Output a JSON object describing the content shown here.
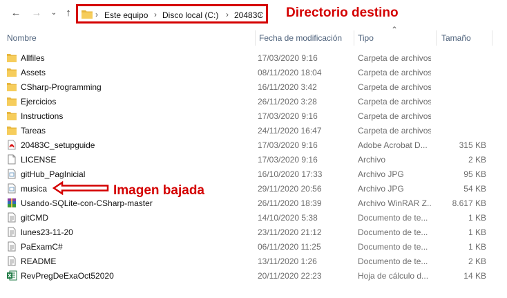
{
  "breadcrumb": [
    "Este equipo",
    "Disco local (C:)",
    "20483C"
  ],
  "annotations": {
    "directory": "Directorio destino",
    "image": "Imagen bajada"
  },
  "columns": {
    "name": "Nombre",
    "date": "Fecha de modificación",
    "type": "Tipo",
    "size": "Tamaño"
  },
  "files": [
    {
      "name": "Allfiles",
      "date": "17/03/2020 9:16",
      "type": "Carpeta de archivos",
      "size": "",
      "icon": "folder-icon"
    },
    {
      "name": "Assets",
      "date": "08/11/2020 18:04",
      "type": "Carpeta de archivos",
      "size": "",
      "icon": "folder-icon"
    },
    {
      "name": "CSharp-Programming",
      "date": "16/11/2020 3:42",
      "type": "Carpeta de archivos",
      "size": "",
      "icon": "folder-icon"
    },
    {
      "name": "Ejercicios",
      "date": "26/11/2020 3:28",
      "type": "Carpeta de archivos",
      "size": "",
      "icon": "folder-icon"
    },
    {
      "name": "Instructions",
      "date": "17/03/2020 9:16",
      "type": "Carpeta de archivos",
      "size": "",
      "icon": "folder-icon"
    },
    {
      "name": "Tareas",
      "date": "24/11/2020 16:47",
      "type": "Carpeta de archivos",
      "size": "",
      "icon": "folder-icon"
    },
    {
      "name": "20483C_setupguide",
      "date": "17/03/2020 9:16",
      "type": "Adobe Acrobat D...",
      "size": "315 KB",
      "icon": "pdf-icon"
    },
    {
      "name": "LICENSE",
      "date": "17/03/2020 9:16",
      "type": "Archivo",
      "size": "2 KB",
      "icon": "file-icon"
    },
    {
      "name": "gitHub_PagInicial",
      "date": "16/10/2020 17:33",
      "type": "Archivo JPG",
      "size": "95 KB",
      "icon": "image-file-icon"
    },
    {
      "name": "musica",
      "date": "29/11/2020 20:56",
      "type": "Archivo JPG",
      "size": "54 KB",
      "icon": "image-file-icon"
    },
    {
      "name": "Usando-SQLite-con-CSharp-master",
      "date": "26/11/2020 18:39",
      "type": "Archivo WinRAR Z...",
      "size": "8.617 KB",
      "icon": "winrar-icon"
    },
    {
      "name": "gitCMD",
      "date": "14/10/2020 5:38",
      "type": "Documento de te...",
      "size": "1 KB",
      "icon": "text-file-icon"
    },
    {
      "name": "lunes23-11-20",
      "date": "23/11/2020 21:12",
      "type": "Documento de te...",
      "size": "1 KB",
      "icon": "text-file-icon"
    },
    {
      "name": "PaExamC#",
      "date": "06/11/2020 11:25",
      "type": "Documento de te...",
      "size": "1 KB",
      "icon": "text-file-icon"
    },
    {
      "name": "README",
      "date": "13/11/2020 1:26",
      "type": "Documento de te...",
      "size": "2 KB",
      "icon": "text-file-icon"
    },
    {
      "name": "RevPregDeExaOct52020",
      "date": "20/11/2020 22:23",
      "type": "Hoja de cálculo d...",
      "size": "14 KB",
      "icon": "excel-icon"
    }
  ],
  "colors": {
    "annotation": "#d40000",
    "folder": "#e8b73e",
    "header_text": "#4c607a"
  }
}
